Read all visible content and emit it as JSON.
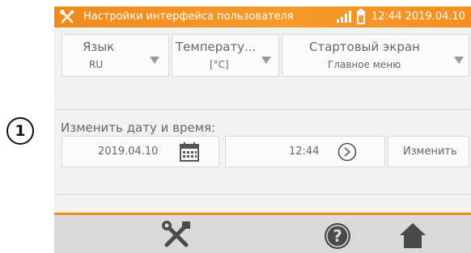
{
  "marker": {
    "number": "1"
  },
  "statusbar": {
    "title": "Настройки интерфейса пользователя",
    "datetime": "12:44 2019.04.10",
    "icons": [
      "tools-icon",
      "signal-icon",
      "battery-icon"
    ],
    "color": "#f08a1c"
  },
  "settings": {
    "language": {
      "label": "Язык",
      "value": "RU"
    },
    "temperature": {
      "label": "Температу...",
      "value": "[°C]"
    },
    "start_screen": {
      "label": "Стартовый экран",
      "value": "Главное меню"
    }
  },
  "datetime_section": {
    "label": "Изменить дату и время:",
    "date_value": "2019.04.10",
    "time_value": "12:44",
    "change_button": "Изменить"
  },
  "bottombar": {
    "icons": [
      "tools-icon",
      "help-icon",
      "home-icon"
    ]
  }
}
